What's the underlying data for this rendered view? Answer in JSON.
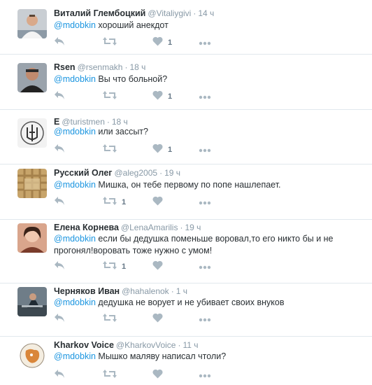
{
  "tweets": [
    {
      "name": "Виталий Глембоцкий",
      "handle": "@Vitaliygivi",
      "time": "14 ч",
      "mention": "@mdobkin",
      "text": " хороший анекдот",
      "line2": "",
      "retweets": "",
      "likes": "1",
      "avatar": "man-white-shirt"
    },
    {
      "name": "Rsen",
      "handle": "@rsenmakh",
      "time": "18 ч",
      "mention": "@mdobkin",
      "text": " Вы что больной?",
      "line2": "",
      "retweets": "",
      "likes": "1",
      "avatar": "man-dark"
    },
    {
      "name": "E",
      "handle": "@turistmen",
      "time": "18 ч",
      "mention": "@mdobkin",
      "text": " или зассыт?",
      "line2": "",
      "retweets": "",
      "likes": "1",
      "avatar": "trident"
    },
    {
      "name": "Русский Олег",
      "handle": "@aleg2005",
      "time": "19 ч",
      "mention": "@mdobkin",
      "text": " Мишка, он тебе первому по попе нашлепает.",
      "line2": "",
      "retweets": "1",
      "likes": "",
      "avatar": "woven"
    },
    {
      "name": "Елена Корнева",
      "handle": "@LenaAmarilis",
      "time": "19 ч",
      "mention": "@mdobkin",
      "text": " если бы дедушка поменьше воровал,то его никто бы и не",
      "line2": "прогонял!воровать тоже нужно с умом!",
      "retweets": "1",
      "likes": "",
      "avatar": "woman"
    },
    {
      "name": "Черняков Иван",
      "handle": "@hahalenok",
      "time": "1 ч",
      "mention": "@mdobkin",
      "text": " дедушка не ворует и не убивает своих внуков",
      "line2": "",
      "retweets": "",
      "likes": "",
      "avatar": "workout"
    },
    {
      "name": "Kharkov Voice",
      "handle": "@KharkovVoice",
      "time": "11 ч",
      "mention": "@mdobkin",
      "text": " Мышко маляву написал чтоли?",
      "line2": "",
      "retweets": "",
      "likes": "",
      "avatar": "map-badge"
    }
  ],
  "icons": {
    "reply": "reply-icon",
    "retweet": "retweet-icon",
    "like": "heart-icon",
    "more": "more-icon"
  },
  "colors": {
    "mention": "#1b95e0",
    "meta": "#8899a6",
    "icon": "#aab8c2",
    "divider": "#e1e8ed"
  }
}
